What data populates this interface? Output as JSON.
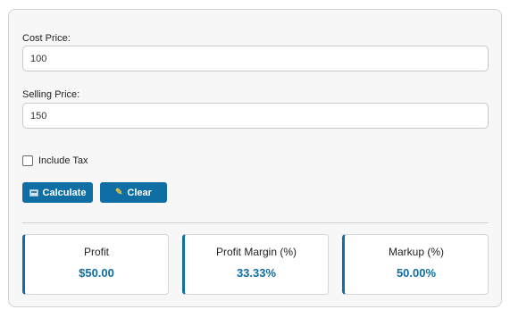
{
  "form": {
    "cost_price": {
      "label": "Cost Price:",
      "value": "100"
    },
    "selling_price": {
      "label": "Selling Price:",
      "value": "150"
    },
    "include_tax": {
      "label": "Include Tax",
      "checked": false
    }
  },
  "buttons": {
    "calculate": {
      "label": "Calculate",
      "icon": "calculator-icon"
    },
    "clear": {
      "label": "Clear",
      "icon": "broom-icon"
    }
  },
  "results": [
    {
      "title": "Profit",
      "value": "$50.00"
    },
    {
      "title": "Profit Margin (%)",
      "value": "33.33%"
    },
    {
      "title": "Markup (%)",
      "value": "50.00%"
    }
  ],
  "colors": {
    "accent": "#0f6ea3",
    "panel_background": "#f7f7f7"
  }
}
